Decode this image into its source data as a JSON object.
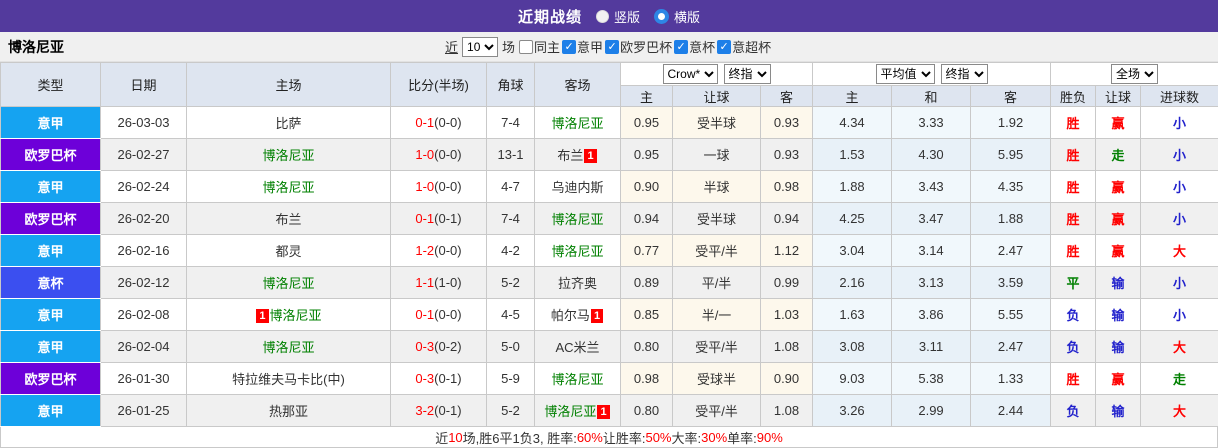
{
  "header": {
    "title": "近期战绩",
    "radios": [
      {
        "name": "radio-vertical",
        "label": "竖版",
        "selected": false
      },
      {
        "name": "radio-horizontal",
        "label": "横版",
        "selected": true
      }
    ]
  },
  "filter": {
    "team": "博洛尼亚",
    "near_label": "近",
    "games_value": "10",
    "games_suffix": "场",
    "checkboxes": [
      {
        "name": "checkbox-same-home",
        "label": "同主",
        "checked": false
      },
      {
        "name": "checkbox-serie-a",
        "label": "意甲",
        "checked": true
      },
      {
        "name": "checkbox-europa-league",
        "label": "欧罗巴杯",
        "checked": true
      },
      {
        "name": "checkbox-coppa-italia",
        "label": "意杯",
        "checked": true
      },
      {
        "name": "checkbox-italian-super-cup",
        "label": "意超杯",
        "checked": true
      }
    ]
  },
  "controls": {
    "bookmaker": "Crow*",
    "handicap_time": "终指",
    "europe_avg": "平均值",
    "europe_time": "终指",
    "scope": "全场"
  },
  "table": {
    "columns": [
      "类型",
      "日期",
      "主场",
      "比分(半场)",
      "角球",
      "客场",
      "主",
      "让球",
      "客",
      "主",
      "和",
      "客",
      "胜负",
      "让球",
      "进球数"
    ],
    "rows": [
      {
        "type": "意甲",
        "type_color": "#15a3f1",
        "date": "26-03-03",
        "home": {
          "text": "比萨",
          "green": false
        },
        "score": "0-1",
        "half": "(0-0)",
        "corner": "7-4",
        "away": {
          "text": "博洛尼亚",
          "green": true
        },
        "ah": [
          "0.95",
          "受半球",
          "0.93"
        ],
        "eu": [
          "4.34",
          "3.33",
          "1.92"
        ],
        "results": [
          {
            "text": "胜",
            "color": "#ff0000"
          },
          {
            "text": "赢",
            "color": "#ff0000"
          },
          {
            "text": "小",
            "color": "#2222cc"
          }
        ]
      },
      {
        "type": "欧罗巴杯",
        "type_color": "#6d00d9",
        "date": "26-02-27",
        "home": {
          "text": "博洛尼亚",
          "green": true
        },
        "score": "1-0",
        "half": "(0-0)",
        "corner": "13-1",
        "away": {
          "text": "布兰",
          "green": false,
          "badge": "1",
          "badge_pos": "after"
        },
        "ah": [
          "0.95",
          "一球",
          "0.93"
        ],
        "eu": [
          "1.53",
          "4.30",
          "5.95"
        ],
        "results": [
          {
            "text": "胜",
            "color": "#ff0000"
          },
          {
            "text": "走",
            "color": "#008000"
          },
          {
            "text": "小",
            "color": "#2222cc"
          }
        ]
      },
      {
        "type": "意甲",
        "type_color": "#15a3f1",
        "date": "26-02-24",
        "home": {
          "text": "博洛尼亚",
          "green": true
        },
        "score": "1-0",
        "half": "(0-0)",
        "corner": "4-7",
        "away": {
          "text": "乌迪内斯",
          "green": false
        },
        "ah": [
          "0.90",
          "半球",
          "0.98"
        ],
        "eu": [
          "1.88",
          "3.43",
          "4.35"
        ],
        "results": [
          {
            "text": "胜",
            "color": "#ff0000"
          },
          {
            "text": "赢",
            "color": "#ff0000"
          },
          {
            "text": "小",
            "color": "#2222cc"
          }
        ]
      },
      {
        "type": "欧罗巴杯",
        "type_color": "#6d00d9",
        "date": "26-02-20",
        "home": {
          "text": "布兰",
          "green": false
        },
        "score": "0-1",
        "half": "(0-1)",
        "corner": "7-4",
        "away": {
          "text": "博洛尼亚",
          "green": true
        },
        "ah": [
          "0.94",
          "受半球",
          "0.94"
        ],
        "eu": [
          "4.25",
          "3.47",
          "1.88"
        ],
        "results": [
          {
            "text": "胜",
            "color": "#ff0000"
          },
          {
            "text": "赢",
            "color": "#ff0000"
          },
          {
            "text": "小",
            "color": "#2222cc"
          }
        ]
      },
      {
        "type": "意甲",
        "type_color": "#15a3f1",
        "date": "26-02-16",
        "home": {
          "text": "都灵",
          "green": false
        },
        "score": "1-2",
        "half": "(0-0)",
        "corner": "4-2",
        "away": {
          "text": "博洛尼亚",
          "green": true
        },
        "ah": [
          "0.77",
          "受平/半",
          "1.12"
        ],
        "eu": [
          "3.04",
          "3.14",
          "2.47"
        ],
        "results": [
          {
            "text": "胜",
            "color": "#ff0000"
          },
          {
            "text": "赢",
            "color": "#ff0000"
          },
          {
            "text": "大",
            "color": "#ff0000"
          }
        ]
      },
      {
        "type": "意杯",
        "type_color": "#3b4ff0",
        "date": "26-02-12",
        "home": {
          "text": "博洛尼亚",
          "green": true
        },
        "score": "1-1",
        "half": "(1-0)",
        "corner": "5-2",
        "away": {
          "text": "拉齐奥",
          "green": false
        },
        "ah": [
          "0.89",
          "平/半",
          "0.99"
        ],
        "eu": [
          "2.16",
          "3.13",
          "3.59"
        ],
        "results": [
          {
            "text": "平",
            "color": "#008000"
          },
          {
            "text": "输",
            "color": "#2222cc"
          },
          {
            "text": "小",
            "color": "#2222cc"
          }
        ]
      },
      {
        "type": "意甲",
        "type_color": "#15a3f1",
        "date": "26-02-08",
        "home": {
          "text": "博洛尼亚",
          "green": true,
          "badge": "1",
          "badge_pos": "before"
        },
        "score": "0-1",
        "half": "(0-0)",
        "corner": "4-5",
        "away": {
          "text": "帕尔马",
          "green": false,
          "badge": "1",
          "badge_pos": "after"
        },
        "ah": [
          "0.85",
          "半/一",
          "1.03"
        ],
        "eu": [
          "1.63",
          "3.86",
          "5.55"
        ],
        "results": [
          {
            "text": "负",
            "color": "#2222cc"
          },
          {
            "text": "输",
            "color": "#2222cc"
          },
          {
            "text": "小",
            "color": "#2222cc"
          }
        ]
      },
      {
        "type": "意甲",
        "type_color": "#15a3f1",
        "date": "26-02-04",
        "home": {
          "text": "博洛尼亚",
          "green": true
        },
        "score": "0-3",
        "half": "(0-2)",
        "corner": "5-0",
        "away": {
          "text": "AC米兰",
          "green": false
        },
        "ah": [
          "0.80",
          "受平/半",
          "1.08"
        ],
        "eu": [
          "3.08",
          "3.11",
          "2.47"
        ],
        "results": [
          {
            "text": "负",
            "color": "#2222cc"
          },
          {
            "text": "输",
            "color": "#2222cc"
          },
          {
            "text": "大",
            "color": "#ff0000"
          }
        ]
      },
      {
        "type": "欧罗巴杯",
        "type_color": "#6d00d9",
        "date": "26-01-30",
        "home": {
          "text": "特拉维夫马卡比(中)",
          "green": false
        },
        "score": "0-3",
        "half": "(0-1)",
        "corner": "5-9",
        "away": {
          "text": "博洛尼亚",
          "green": true
        },
        "ah": [
          "0.98",
          "受球半",
          "0.90"
        ],
        "eu": [
          "9.03",
          "5.38",
          "1.33"
        ],
        "results": [
          {
            "text": "胜",
            "color": "#ff0000"
          },
          {
            "text": "赢",
            "color": "#ff0000"
          },
          {
            "text": "走",
            "color": "#008000"
          }
        ]
      },
      {
        "type": "意甲",
        "type_color": "#15a3f1",
        "date": "26-01-25",
        "home": {
          "text": "热那亚",
          "green": false
        },
        "score": "3-2",
        "half": "(0-1)",
        "corner": "5-2",
        "away": {
          "text": "博洛尼亚",
          "green": true,
          "badge": "1",
          "badge_pos": "after"
        },
        "ah": [
          "0.80",
          "受平/半",
          "1.08"
        ],
        "eu": [
          "3.26",
          "2.99",
          "2.44"
        ],
        "results": [
          {
            "text": "负",
            "color": "#2222cc"
          },
          {
            "text": "输",
            "color": "#2222cc"
          },
          {
            "text": "大",
            "color": "#ff0000"
          }
        ]
      }
    ]
  },
  "footer": {
    "segments": [
      {
        "text": "近",
        "color": "#333333"
      },
      {
        "text": "10",
        "color": "#ff0000"
      },
      {
        "text": "场,胜6平1负3, 胜率:",
        "color": "#333333"
      },
      {
        "text": "60%",
        "color": "#ff0000"
      },
      {
        "text": " 让胜率:",
        "color": "#333333"
      },
      {
        "text": "50%",
        "color": "#ff0000"
      },
      {
        "text": " 大率:",
        "color": "#333333"
      },
      {
        "text": "30%",
        "color": "#ff0000"
      },
      {
        "text": " 单率:",
        "color": "#333333"
      },
      {
        "text": "90%",
        "color": "#ff0000"
      }
    ]
  }
}
